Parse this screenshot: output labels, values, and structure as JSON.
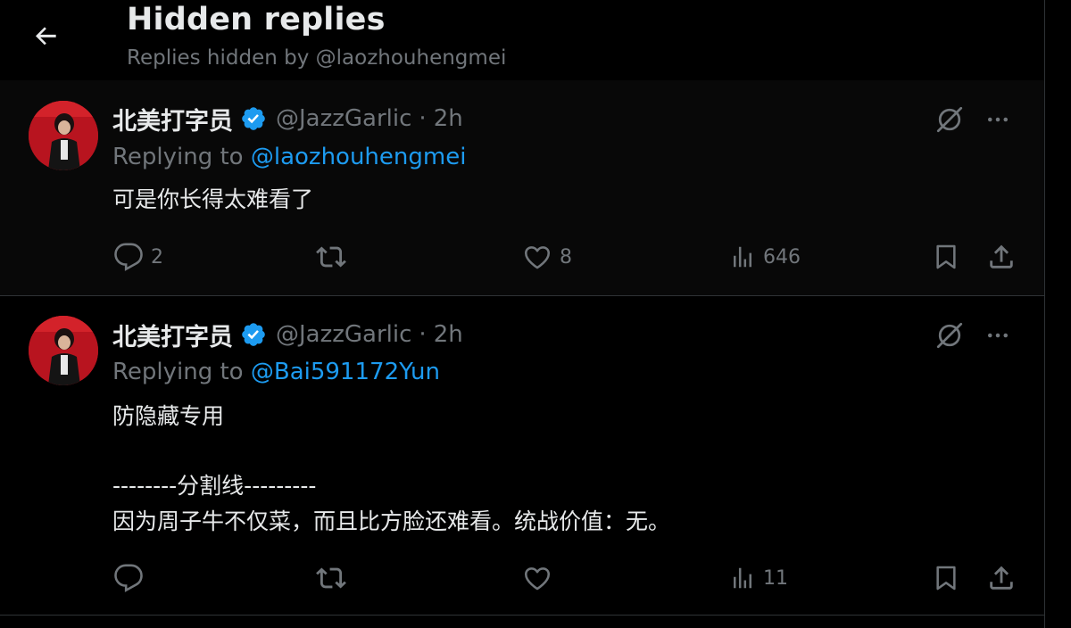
{
  "header": {
    "title": "Hidden replies",
    "subtitle": "Replies hidden by @laozhouhengmei"
  },
  "icons": {
    "back": "arrow-left-icon",
    "verified": "verified-badge-icon",
    "unhide": "eye-slash-icon",
    "more": "more-dots-icon",
    "reply": "reply-icon",
    "retweet": "retweet-icon",
    "like": "heart-icon",
    "views": "views-icon",
    "bookmark": "bookmark-icon",
    "share": "share-icon"
  },
  "colors": {
    "accent": "#1d9bf0",
    "muted": "#71767b",
    "text": "#e7e9ea",
    "background": "#000000"
  },
  "tweets": [
    {
      "display_name": "北美打字员",
      "handle": "@JazzGarlic",
      "separator": "·",
      "time": "2h",
      "replying_prefix": "Replying to",
      "replying_to": "@laozhouhengmei",
      "lines": [
        "可是你长得太难看了"
      ],
      "reply_count": "2",
      "retweet_count": "",
      "like_count": "8",
      "view_count": "646"
    },
    {
      "display_name": "北美打字员",
      "handle": "@JazzGarlic",
      "separator": "·",
      "time": "2h",
      "replying_prefix": "Replying to",
      "replying_to": "@Bai591172Yun",
      "lines": [
        "防隐藏专用",
        "--------分割线---------",
        "因为周子牛不仅菜，而且比方脸还难看。统战价值：无。"
      ],
      "reply_count": "",
      "retweet_count": "",
      "like_count": "",
      "view_count": "11"
    }
  ]
}
